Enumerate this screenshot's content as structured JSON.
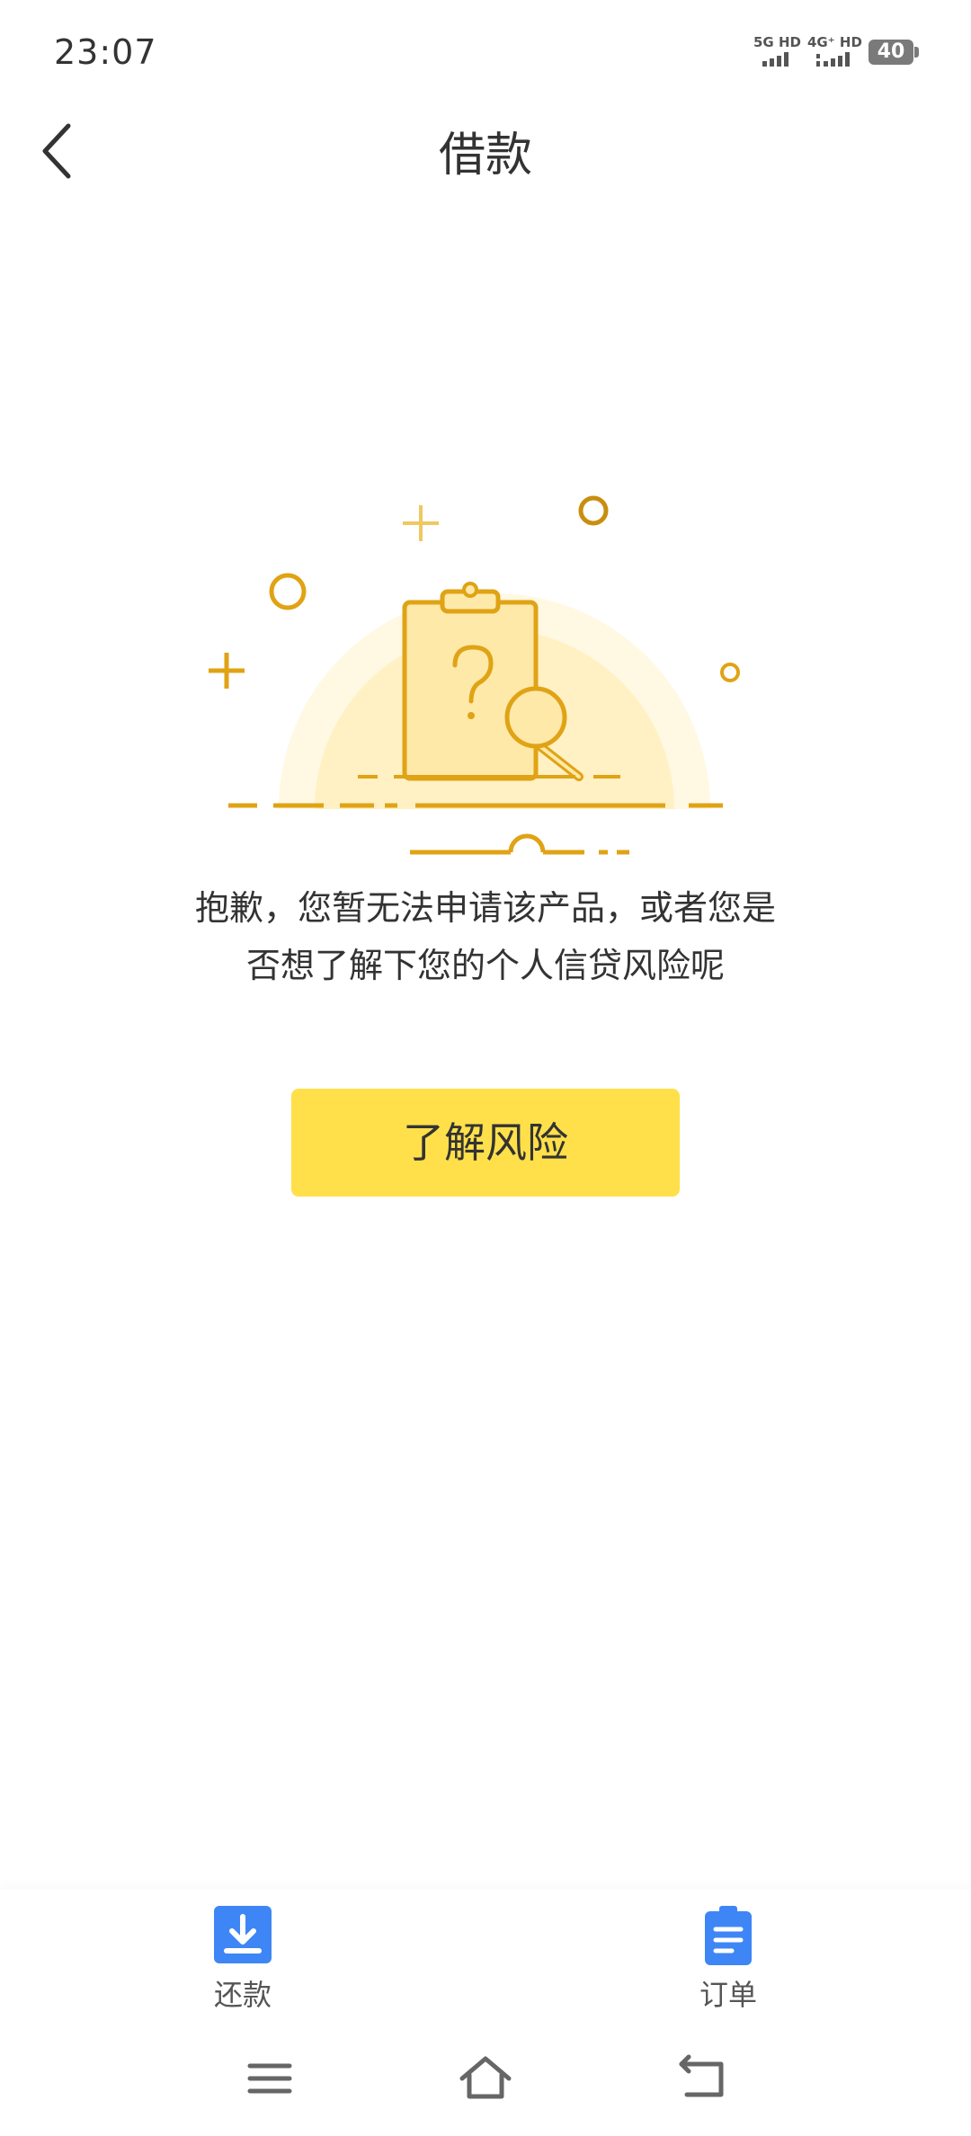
{
  "status_bar": {
    "time": "23:07",
    "network_1": "5G HD",
    "network_2": "4G⁺ HD",
    "battery": "40"
  },
  "nav": {
    "title": "借款",
    "back_icon": "chevron-left-icon"
  },
  "illustration": {
    "icon": "clipboard-question-magnifier-icon",
    "colors": {
      "stroke": "#e0a315",
      "fill": "#ffe9a8",
      "glow_outer": "#fff8e3",
      "glow_inner": "#fff1c4"
    }
  },
  "message": {
    "text": "抱歉，您暂无法申请该产品，或者您是否想了解下您的个人信贷风险呢"
  },
  "cta": {
    "label": "了解风险",
    "color": "#ffe04a"
  },
  "tabs": [
    {
      "label": "还款",
      "icon": "download-tray-icon",
      "color": "#3e86f5"
    },
    {
      "label": "订单",
      "icon": "clipboard-list-icon",
      "color": "#3e86f5"
    }
  ],
  "system_nav": {
    "menu_icon": "menu-icon",
    "home_icon": "home-icon",
    "back_icon": "back-arrow-icon"
  }
}
